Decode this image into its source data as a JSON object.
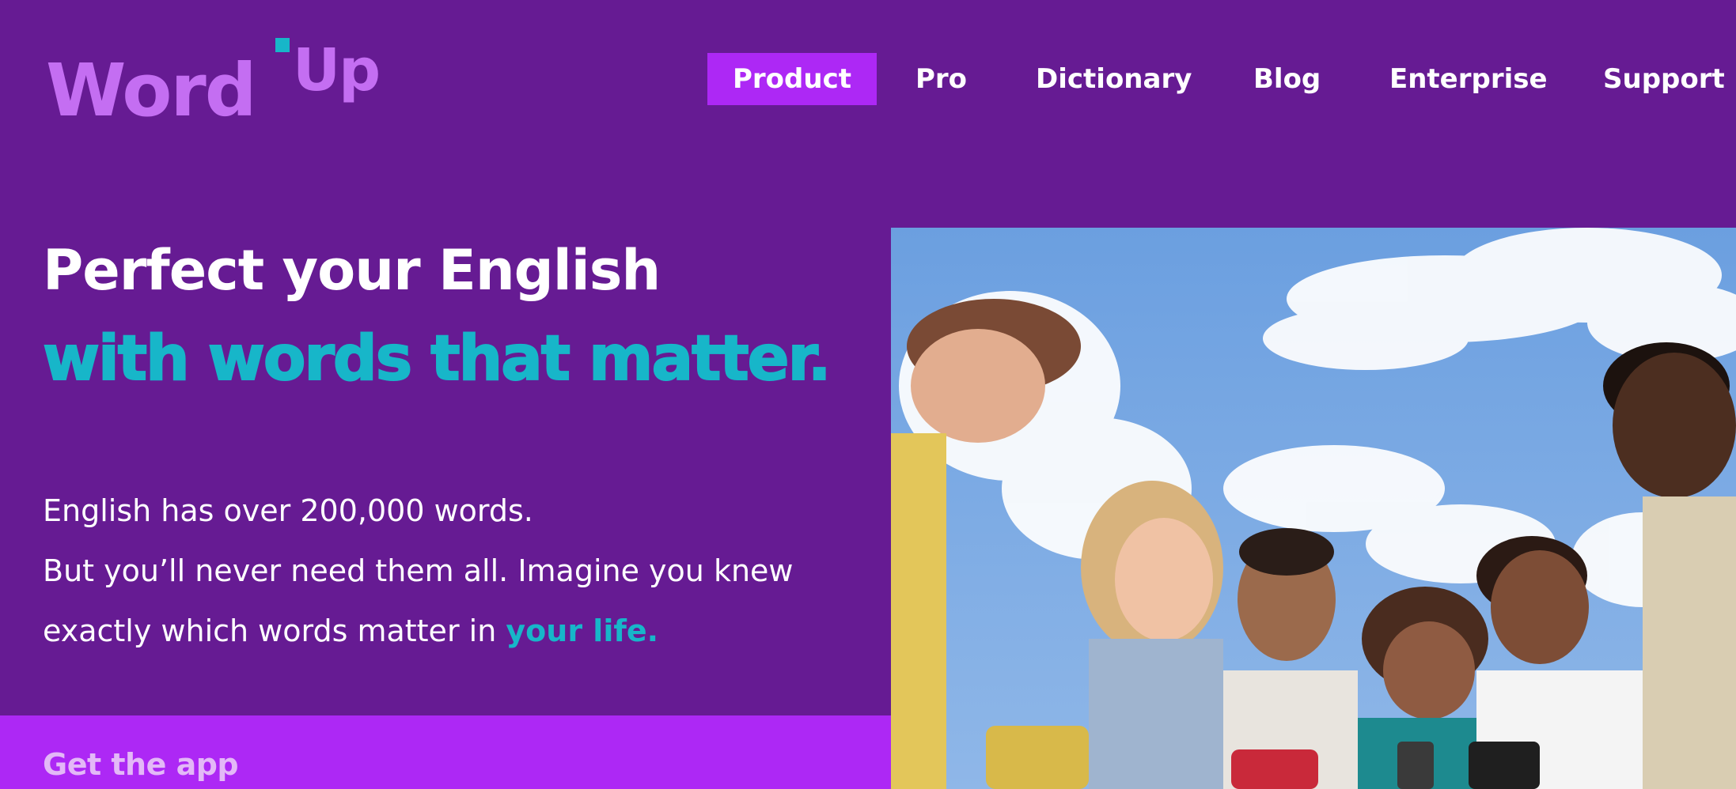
{
  "brand": {
    "name": "WordUp",
    "logo_text_main": "Word",
    "logo_text_up": "Up",
    "colors": {
      "background": "#661b93",
      "accent_purple": "#ad28f5",
      "accent_teal": "#17b6c9",
      "logo_lilac": "#c46ef2"
    }
  },
  "nav": {
    "items": [
      {
        "label": "Product",
        "active": true
      },
      {
        "label": "Pro",
        "active": false
      },
      {
        "label": "Dictionary",
        "active": false
      },
      {
        "label": "Blog",
        "active": false
      },
      {
        "label": "Enterprise",
        "active": false
      },
      {
        "label": "Support",
        "active": false
      }
    ]
  },
  "hero": {
    "headline": "Perfect your English",
    "subheadline": "with words that matter.",
    "body_line1": "English has over 200,000 words.",
    "body_line2": "But you’ll never need them all. Imagine you knew",
    "body_line3_prefix": "exactly which words matter in",
    "body_line3_accent": "your life.",
    "image_description_icon": "group-of-friends-photo"
  },
  "cta": {
    "label": "Get the app"
  }
}
